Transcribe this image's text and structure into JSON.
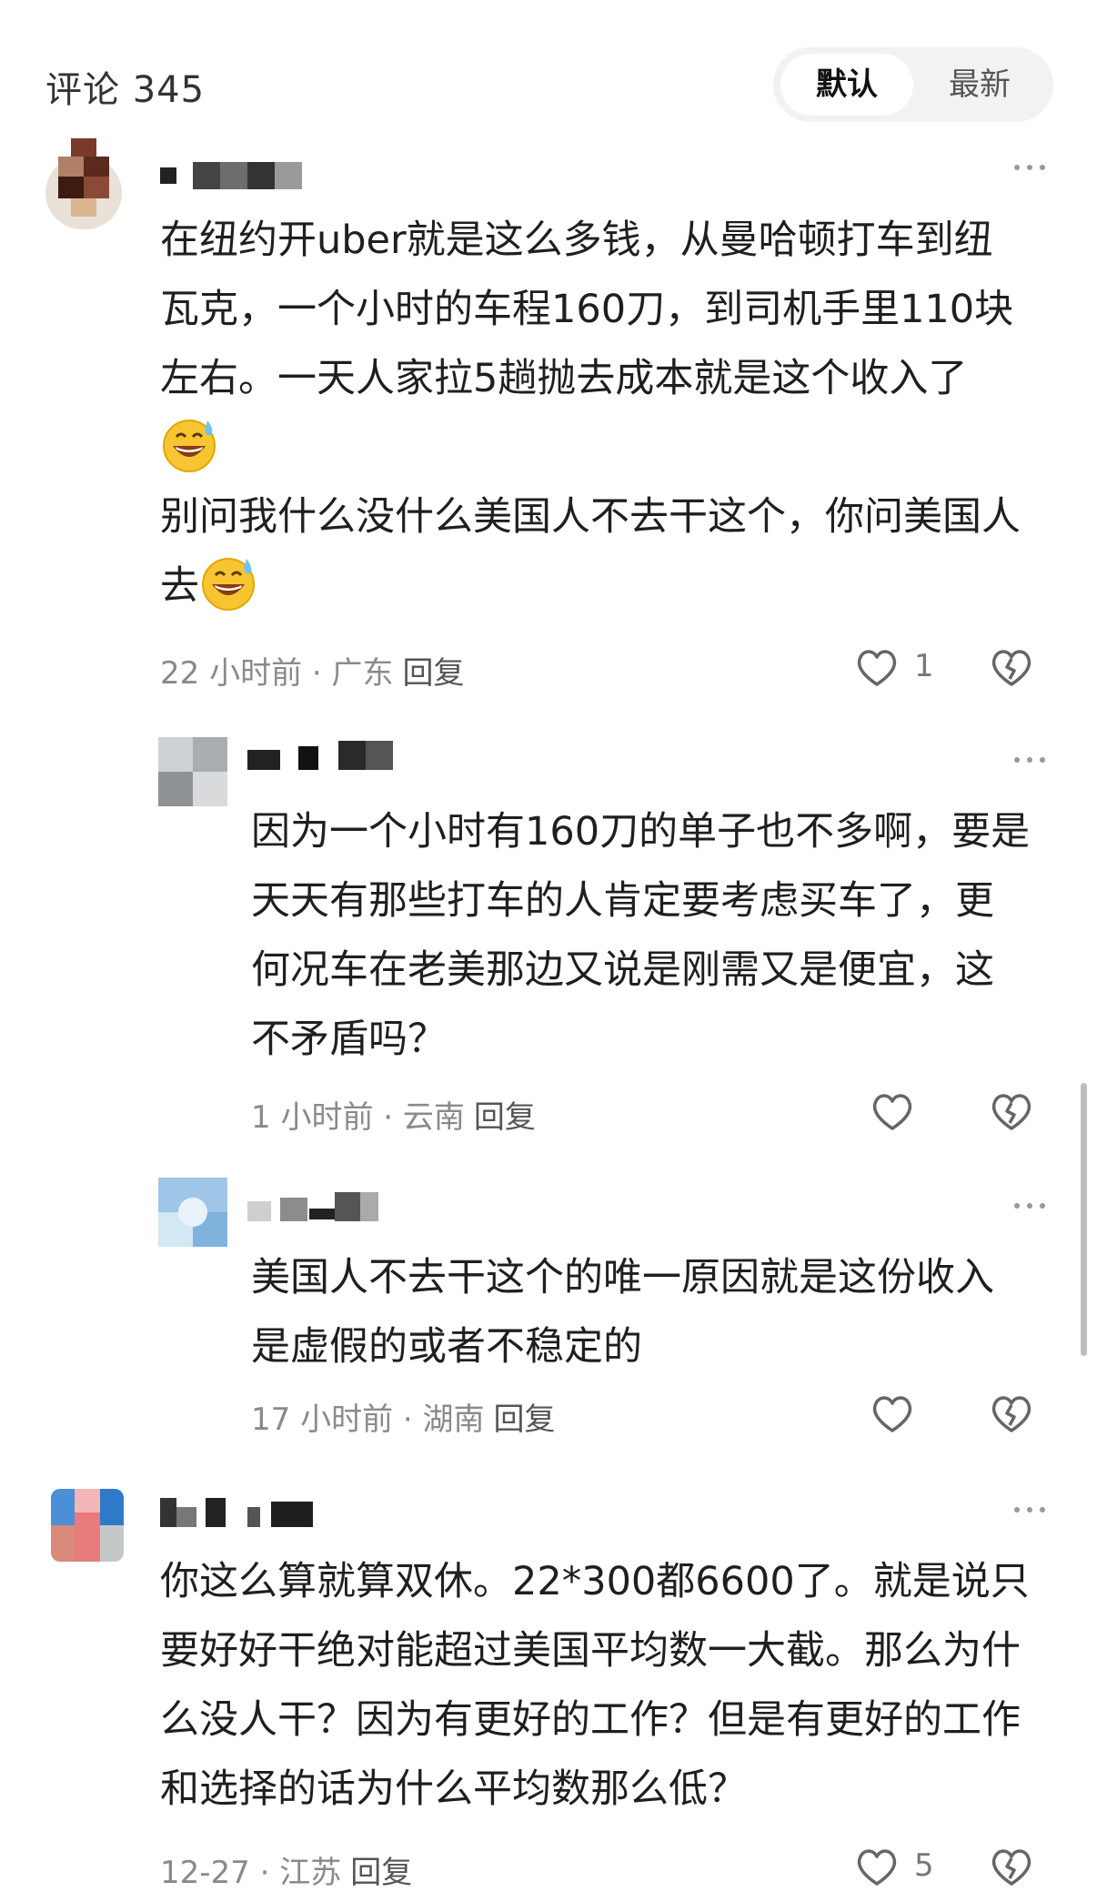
{
  "header": {
    "title": "评论 345",
    "sort_default": "默认",
    "sort_latest": "最新"
  },
  "comments": [
    {
      "lines": [
        "在纽约开uber就是这么多钱，从曼哈顿打车到纽",
        "瓦克，一个小时的车程160刀，到司机手里110块",
        "左右。一天人家拉5趟抛去成本就是这个收入了"
      ],
      "line4": "别问我什么没什么美国人不去干这个，你问美国人",
      "line5": "去",
      "time": "22 小时前",
      "location": "广东",
      "reply": "回复",
      "likes": "1"
    },
    {
      "lines": [
        "因为一个小时有160刀的单子也不多啊，要是",
        "天天有那些打车的人肯定要考虑买车了，更",
        "何况车在老美那边又说是刚需又是便宜，这",
        "不矛盾吗？"
      ],
      "time": "1 小时前",
      "location": "云南",
      "reply": "回复"
    },
    {
      "lines": [
        "美国人不去干这个的唯一原因就是这份收入",
        "是虚假的或者不稳定的"
      ],
      "time": "17 小时前",
      "location": "湖南",
      "reply": "回复"
    },
    {
      "lines": [
        "你这么算就算双休。22*300都6600了。就是说只",
        "要好好干绝对能超过美国平均数一大截。那么为什",
        "么没人干？因为有更好的工作？但是有更好的工作",
        "和选择的话为什么平均数那么低？"
      ],
      "time": "12-27",
      "location": "江苏",
      "reply": "回复",
      "likes": "5"
    }
  ],
  "separator": " · ",
  "icons": [
    "more-icon",
    "heart-icon",
    "dislike-heart-icon",
    "grinning-sweat-emoji"
  ]
}
